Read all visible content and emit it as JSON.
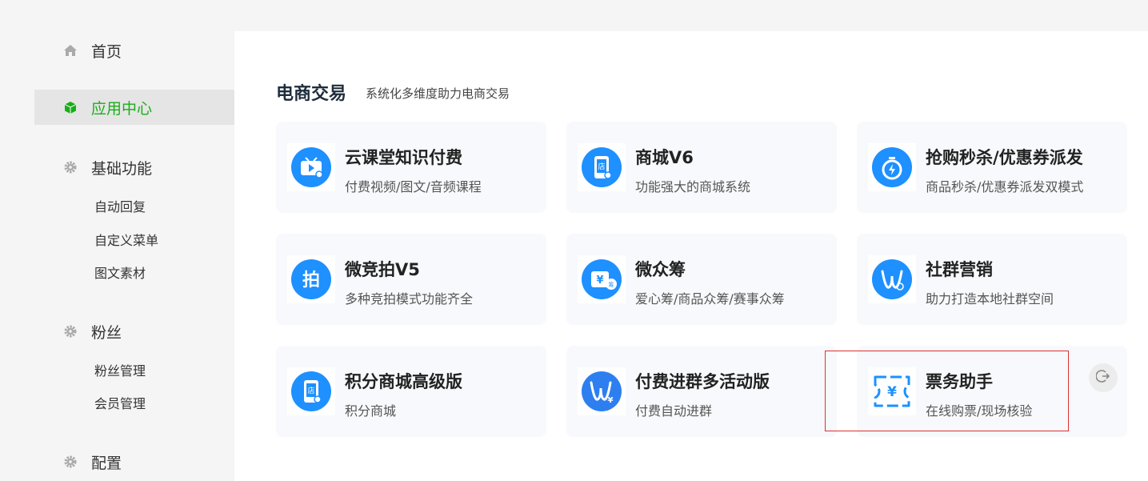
{
  "sidebar": {
    "items": [
      {
        "label": "首页",
        "icon": "home-icon"
      },
      {
        "label": "应用中心",
        "icon": "cube-icon",
        "active": true
      },
      {
        "label": "基础功能",
        "icon": "gear-icon",
        "children": [
          "自动回复",
          "自定义菜单",
          "图文素材"
        ]
      },
      {
        "label": "粉丝",
        "icon": "gear-icon",
        "children": [
          "粉丝管理",
          "会员管理"
        ]
      },
      {
        "label": "配置",
        "icon": "gear-icon"
      }
    ]
  },
  "main": {
    "section_title": "电商交易",
    "section_subtitle": "系统化多维度助力电商交易",
    "cards": [
      {
        "title": "云课堂知识付费",
        "desc": "付费视频/图文/音频课程",
        "icon": "tv-play-icon"
      },
      {
        "title": "商城V6",
        "desc": "功能强大的商城系统",
        "icon": "shop-phone-icon"
      },
      {
        "title": "抢购秒杀/优惠券派发",
        "desc": "商品秒杀/优惠券派发双模式",
        "icon": "stopwatch-icon"
      },
      {
        "title": "微竞拍V5",
        "desc": "多种竞拍模式功能齐全",
        "icon": "auction-icon"
      },
      {
        "title": "微众筹",
        "desc": "爱心筹/商品众筹/赛事众筹",
        "icon": "crowdfund-icon"
      },
      {
        "title": "社群营销",
        "desc": "助力打造本地社群空间",
        "icon": "community-icon"
      },
      {
        "title": "积分商城高级版",
        "desc": "积分商城",
        "icon": "shop-phone-icon"
      },
      {
        "title": "付费进群多活动版",
        "desc": "付费自动进群",
        "icon": "paid-group-icon"
      },
      {
        "title": "票务助手",
        "desc": "在线购票/现场核验",
        "icon": "ticket-icon"
      }
    ]
  },
  "colors": {
    "accent": "#1aad19",
    "icon_blue": "#1e90ff",
    "highlight": "#e03030"
  }
}
